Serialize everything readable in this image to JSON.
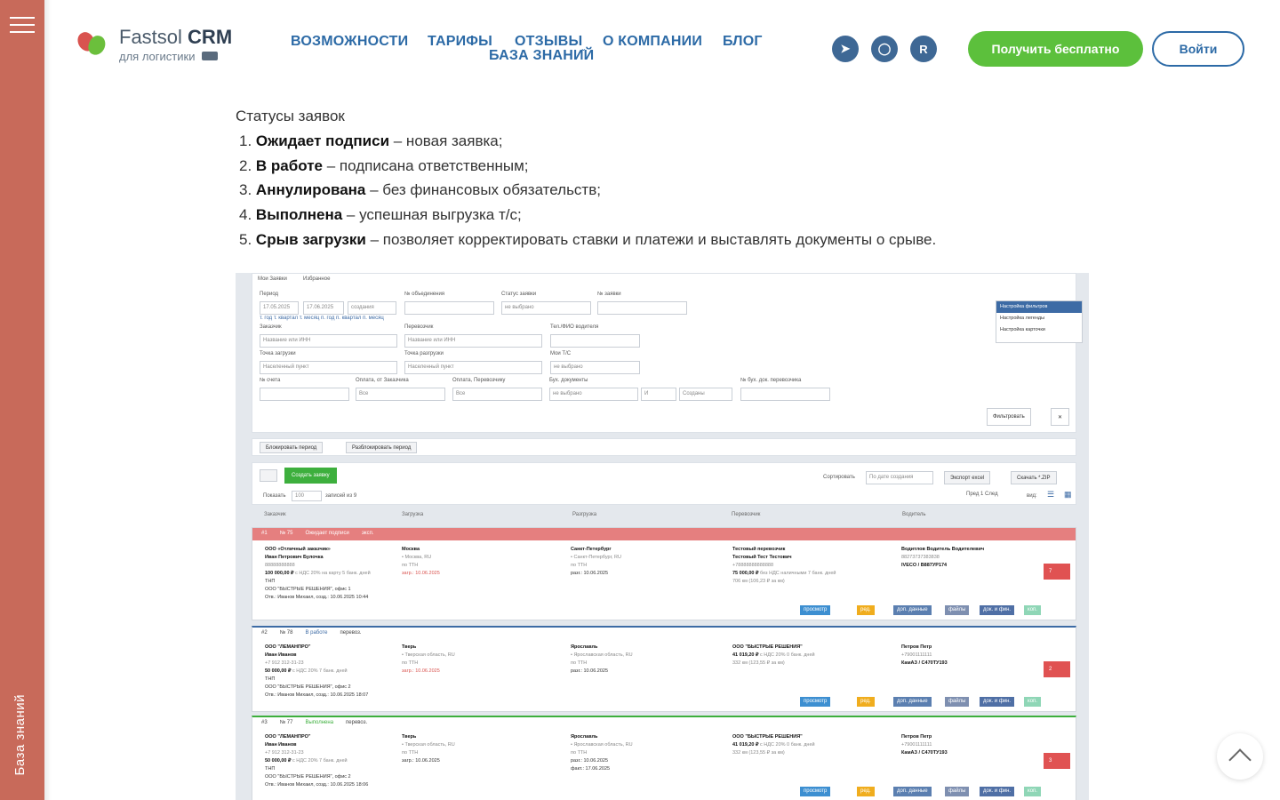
{
  "sidebar": {
    "label": "База знаний"
  },
  "header": {
    "logo_title_a": "Fastsol",
    "logo_title_b": "CRM",
    "logo_subtitle": "для логистики",
    "nav": [
      "ВОЗМОЖНОСТИ",
      "ТАРИФЫ",
      "ОТЗЫВЫ",
      "О КОМПАНИИ",
      "БЛОГ",
      "БАЗА ЗНАНИЙ"
    ],
    "socials": [
      "telegram-icon",
      "max-icon",
      "rutube-icon"
    ],
    "cta_label": "Получить бесплатно",
    "login_label": "Войти"
  },
  "article": {
    "heading": "Статусы заявок",
    "items": [
      {
        "num": "1.",
        "bold": "Ожидает подписи",
        "text": " – новая заявка;"
      },
      {
        "num": "2.",
        "bold": "В работе",
        "text": " – подписана ответственным;"
      },
      {
        "num": "3.",
        "bold": "Аннулирована",
        "text": " – без финансовых обязательств;"
      },
      {
        "num": "4.",
        "bold": "Выполнена",
        "text": " – успешная выгрузка т/с;"
      },
      {
        "num": "5.",
        "bold": "Срыв загрузки",
        "text": " – позволяет корректировать ставки и платежи и выставлять документы о срыве."
      }
    ]
  },
  "crm": {
    "tabs": [
      "Мои Заявки",
      "Избранное"
    ],
    "filters": {
      "period_label": "Период",
      "date_from": "17.05.2025",
      "date_to": "17.06.2025",
      "date_type": "создания",
      "quick_periods": "т. год т. квартал т. месяц п. год п. квартал п. месяц",
      "union_label": "№ объединения",
      "status_label": "Статус заявки",
      "status_value": "не выбрано",
      "order_no_label": "№ заявки",
      "customer_label": "Заказчик",
      "customer_ph": "Название или ИНН",
      "carrier_label": "Перевозчик",
      "carrier_ph": "Название или ИНН",
      "driver_label": "Тел./ФИО водителя",
      "load_label": "Точка загрузки",
      "load_ph": "Населенный пункт",
      "unload_label": "Точка разгрузки",
      "unload_ph": "Населенный пункт",
      "my_ts_label": "Мои Т/С",
      "my_ts_value": "не выбрано",
      "invoice_label": "№ счета",
      "pay_customer_label": "Оплата, от Заказчика",
      "pay_customer_value": "Все",
      "pay_carrier_label": "Оплата, Перевозчику",
      "pay_carrier_value": "Все",
      "acc_docs_label": "Бух. документы",
      "acc_docs_value": "не выбрано",
      "acc_docs_op": "И",
      "acc_docs_state": "Созданы",
      "carrier_doc_label": "№ бух. док. перевозчика",
      "filter_btn": "Фильтровать",
      "menu": [
        "Настройка фильтров",
        "Настройка легенды",
        "Настройка карточки"
      ]
    },
    "lock_btn": "Блокировать период",
    "unlock_btn": "Разблокировать период",
    "create_btn": "Создать заявку",
    "sort_label": "Сортировать",
    "sort_value": "По дате создания",
    "export_btn": "Экспорт excel",
    "zip_btn": "Скачать *.ZIP",
    "show_label": "Показать",
    "show_value": "100",
    "records": "записей из 9",
    "pager": "Пред  1  След",
    "view_label": "вид:",
    "columns": [
      "Заказчик",
      "Загрузка",
      "Разгрузка",
      "Перевозчик",
      "Водитель"
    ],
    "rows": [
      {
        "idx": "#1",
        "num": "№ 75",
        "status": "Ожидает подписи",
        "extra": "эксп.",
        "header_color": "#e57f7f",
        "customer": "ООО «Отличный заказчик»",
        "contact": "Иван Петрович Булочка",
        "phone": "88888888888",
        "price": "100 000,00 ₽",
        "price_note": "с НДС 20% на карту 5 банк. дней",
        "doc": "ТНП",
        "office": "ООО \"БЫСТРЫЕ РЕШЕНИЯ\", офис 1",
        "resp": "Отв.: Иванов Михаил, созд.: 10.06.2025 10:44",
        "load_city": "Москва",
        "load_region": "• Москва, RU",
        "load_doc": "по ТТН",
        "load_date": "загр.: 10.06.2025",
        "unload_city": "Санкт-Петербург",
        "unload_region": "• Санкт-Петербург, RU",
        "unload_doc": "по ТТН",
        "unload_date": "разг.: 10.06.2025",
        "carrier": "Тестовый перевозчик",
        "carrier_contact": "Тестовый Тест Тестович",
        "carrier_phone": "+78888888888888",
        "carrier_price": "75 000,00 ₽",
        "carrier_note": "без НДС наличными 7 банк. дней",
        "carrier_km": "706 км (106,23 ₽ за км)",
        "driver": "Водитлов Водитель Водителевич",
        "driver_phone": "88273737383838",
        "vehicle": "IVECO / В887УР174",
        "msgs": "7"
      },
      {
        "idx": "#2",
        "num": "№ 78",
        "status": "В работе",
        "extra": "перевоз.",
        "header_color": "#ffffff",
        "customer": "ООО \"ЛЕМАНПРО\"",
        "contact": "Иван Иванов",
        "phone": "+7 912 312-31-23",
        "price": "50 000,00 ₽",
        "price_note": "с НДС 20% 7 банк. дней",
        "doc": "ТНП",
        "office": "ООО \"БЫСТРЫЕ РЕШЕНИЯ\", офис 2",
        "resp": "Отв.: Иванов Михаил, созд.: 10.06.2025 18:07",
        "load_city": "Тверь",
        "load_region": "• Тверская область, RU",
        "load_doc": "по ТТН",
        "load_date": "загр.: 10.06.2025",
        "unload_city": "Ярославль",
        "unload_region": "• Ярославская область, RU",
        "unload_doc": "по ТТН",
        "unload_date": "разг.: 10.06.2025",
        "carrier": "ООО \"БЫСТРЫЕ РЕШЕНИЯ\"",
        "carrier_contact": "",
        "carrier_phone": "",
        "carrier_price": "41 019,20 ₽",
        "carrier_note": "с НДС 20% 0 банк. дней",
        "carrier_km": "332 км (123,55 ₽ за км)",
        "driver": "Петров Петр",
        "driver_phone": "+79001111111",
        "vehicle": "КамАЗ / С470ТУ193",
        "msgs": "2"
      },
      {
        "idx": "#3",
        "num": "№ 77",
        "status": "Выполнена",
        "extra": "перевоз.",
        "header_color": "#ffffff",
        "customer": "ООО \"ЛЕМАНПРО\"",
        "contact": "Иван Иванов",
        "phone": "+7 912 312-31-23",
        "price": "50 000,00 ₽",
        "price_note": "с НДС 20% 7 банк. дней",
        "doc": "ТНП",
        "office": "ООО \"БЫСТРЫЕ РЕШЕНИЯ\", офис 2",
        "resp": "Отв.: Иванов Михаил, созд.: 10.06.2025 18:06",
        "load_city": "Тверь",
        "load_region": "• Тверская область, RU",
        "load_doc": "по ТТН",
        "load_date": "загр.: 10.06.2025",
        "unload_city": "Ярославль",
        "unload_region": "• Ярославская область, RU",
        "unload_doc": "по ТТН",
        "unload_date": "разг.: 10.06.2025",
        "unload_fact": "факт.: 17.06.2025",
        "carrier": "ООО \"БЫСТРЫЕ РЕШЕНИЯ\"",
        "carrier_contact": "",
        "carrier_phone": "",
        "carrier_price": "41 019,20 ₽",
        "carrier_note": "с НДС 20% 0 банк. дней",
        "carrier_km": "332 км (123,55 ₽ за км)",
        "driver": "Петров Петр",
        "driver_phone": "+79001111111",
        "vehicle": "КамАЗ / С470ТУ193",
        "msgs": "3"
      }
    ],
    "actions": [
      "просмотр",
      "ред.",
      "доп. данные",
      "файлы",
      "док. и фин.",
      "коп."
    ]
  },
  "colors": {
    "sidebar": "#c86a5a",
    "nav": "#2c6aa6",
    "cta": "#5cc03c",
    "social": "#3e6895"
  }
}
